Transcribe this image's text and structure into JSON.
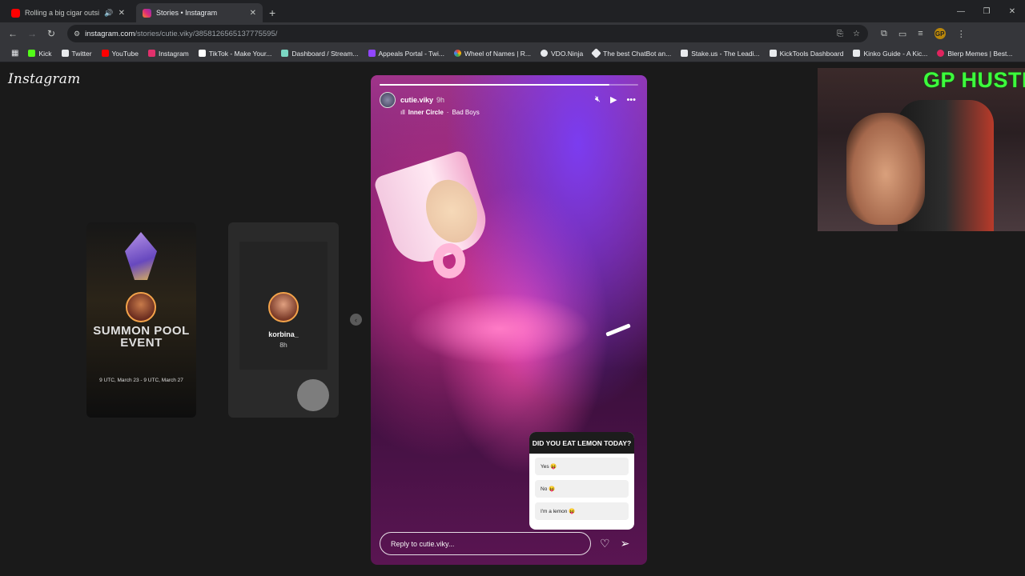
{
  "browser": {
    "tabs": [
      {
        "title": "Rolling a big cigar outside",
        "favicon_color": "#ff0000",
        "audio": true,
        "active": false
      },
      {
        "title": "Stories • Instagram",
        "favicon_color": "#e1306c",
        "audio": false,
        "active": true
      }
    ],
    "url_host": "instagram.com",
    "url_path": "/stories/cutie.viky/3858126565137775595/",
    "bookmarks": [
      {
        "label": "Kick",
        "color": "#53fc18"
      },
      {
        "label": "Twitter",
        "color": "#e8eaed"
      },
      {
        "label": "YouTube",
        "color": "#ff0000"
      },
      {
        "label": "Instagram",
        "color": "#e1306c"
      },
      {
        "label": "TikTok - Make Your...",
        "color": "#ffffff"
      },
      {
        "label": "Dashboard / Stream...",
        "color": "#7ad6c2"
      },
      {
        "label": "Appeals Portal - Twi...",
        "color": "#9146ff"
      },
      {
        "label": "Wheel of Names | R...",
        "color": "#4285f4"
      },
      {
        "label": "VDO.Ninja",
        "color": "#e8eaed"
      },
      {
        "label": "The best ChatBot an...",
        "color": "#e8eaed"
      },
      {
        "label": "Stake.us - The Leadi...",
        "color": "#e8eaed"
      },
      {
        "label": "KickTools Dashboard",
        "color": "#e8eaed"
      },
      {
        "label": "Kinko Guide - A Kic...",
        "color": "#e8eaed"
      },
      {
        "label": "Blerp Memes | Best...",
        "color": "#e0245e"
      }
    ],
    "profile_initial": "GP"
  },
  "instagram": {
    "logo": "Instagram",
    "side_stories": [
      {
        "user": "",
        "time": "",
        "event_title": "SUMMON POOL EVENT",
        "event_date": "9 UTC, March 23 - 9 UTC, March 27"
      },
      {
        "user": "korbina_",
        "time": "8h"
      }
    ],
    "story": {
      "user": "cutie.viky",
      "time": "9h",
      "music_artist": "Inner Circle",
      "music_song": "Bad Boys",
      "progress_fraction": 0.89,
      "poll": {
        "question": "DID YOU EAT LEMON TODAY?",
        "options": [
          "Yes 😝",
          "No 😝",
          "I'm a lemon 😝"
        ]
      },
      "reply_placeholder": "Reply to cutie.viky..."
    }
  },
  "webcam": {
    "overlay_text": "GP HUSTLA"
  }
}
